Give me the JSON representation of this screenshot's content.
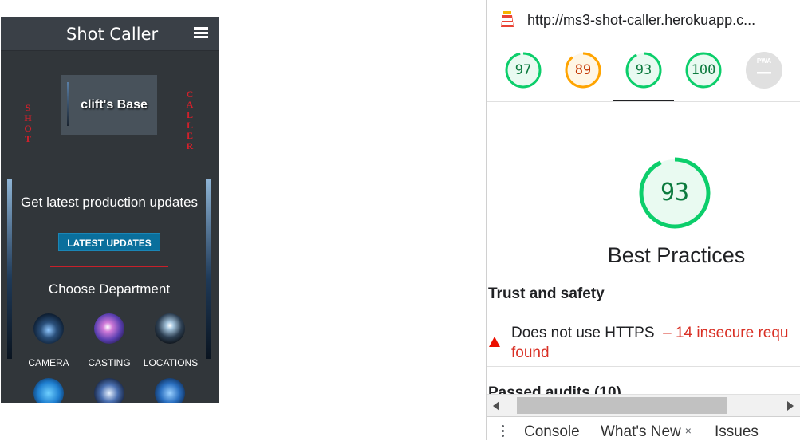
{
  "app": {
    "brand": "Shot Caller",
    "left_vertical": "S\nH\nO\nT",
    "right_vertical": "C\nA\nL\nL\nE\nR",
    "base_title": "clift's Base",
    "updates_title": "Get latest production updates",
    "updates_button": "LATEST UPDATES",
    "dept_title": "Choose Department",
    "departments": [
      {
        "label": "CAMERA",
        "icon": "camera-icon"
      },
      {
        "label": "CASTING",
        "icon": "casting-icon"
      },
      {
        "label": "LOCATIONS",
        "icon": "locations-icon"
      }
    ],
    "accent_color": "#0a6f9c",
    "vertical_text_color": "#d3202b"
  },
  "devtools": {
    "url": "http://ms3-shot-caller.herokuapp.c...",
    "scores": [
      {
        "value": "97",
        "color": "#0cce6b"
      },
      {
        "value": "89",
        "color": "#ffa400"
      },
      {
        "value": "93",
        "color": "#0cce6b"
      },
      {
        "value": "100",
        "color": "#0cce6b"
      }
    ],
    "pwa_badge": "PWA",
    "main_score": "93",
    "main_score_fraction": 0.93,
    "category_title": "Best Practices",
    "section_title": "Trust and safety",
    "audit_title": "Does not use HTTPS",
    "audit_detail_line1": "– 14 insecure requ",
    "audit_detail_line2": "found",
    "passed_audits": "Passed audits (10)",
    "drawer_tabs": [
      "Console",
      "What's New",
      "Issues"
    ],
    "close_glyph": "×"
  }
}
